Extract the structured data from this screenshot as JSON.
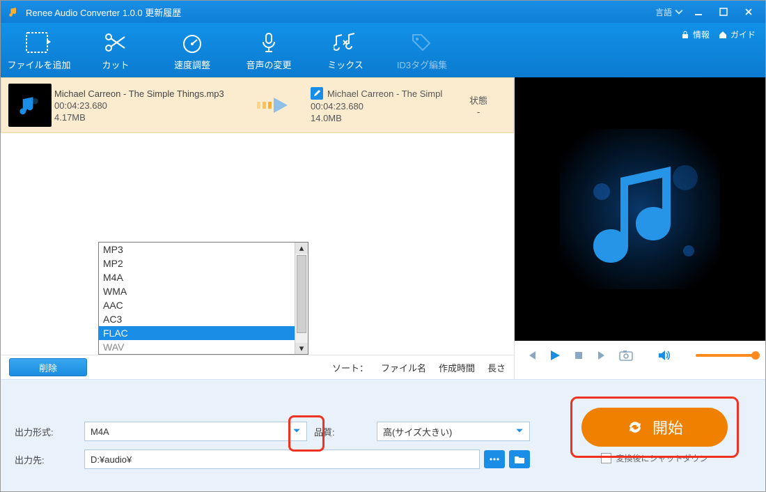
{
  "titlebar": {
    "app_title": "Renee Audio Converter 1.0.0 更新履歴",
    "language_label": "言語"
  },
  "toolbar": {
    "items": [
      {
        "label": "ファイルを追加",
        "id": "add-file"
      },
      {
        "label": "カット",
        "id": "cut"
      },
      {
        "label": "速度調整",
        "id": "speed"
      },
      {
        "label": "音声の変更",
        "id": "voice"
      },
      {
        "label": "ミックス",
        "id": "mix"
      },
      {
        "label": "ID3タグ編集",
        "id": "id3",
        "disabled": true
      }
    ],
    "info_label": "情報",
    "guide_label": "ガイド"
  },
  "file": {
    "source": {
      "name": "Michael Carreon - The Simple Things.mp3",
      "duration": "00:04:23.680",
      "size": "4.17MB"
    },
    "output": {
      "name": "Michael Carreon - The Simpl",
      "duration": "00:04:23.680",
      "size": "14.0MB"
    },
    "state_header": "状態",
    "state_value": "-"
  },
  "listbar": {
    "delete_label": "削除",
    "sort_label": "ソート：",
    "sort_options": [
      "ファイル名",
      "作成時間",
      "長さ"
    ]
  },
  "format_dropdown": {
    "options": [
      "MP3",
      "MP2",
      "M4A",
      "WMA",
      "AAC",
      "AC3",
      "FLAC",
      "WAV"
    ],
    "selected_index": 6
  },
  "settings": {
    "format_label": "出力形式:",
    "format_value": "M4A",
    "quality_label": "品質:",
    "quality_value": "高(サイズ大きい)",
    "output_label": "出力先:",
    "output_value": "D:¥audio¥",
    "start_label": "開始",
    "shutdown_label": "変換後にシャットダウン"
  }
}
